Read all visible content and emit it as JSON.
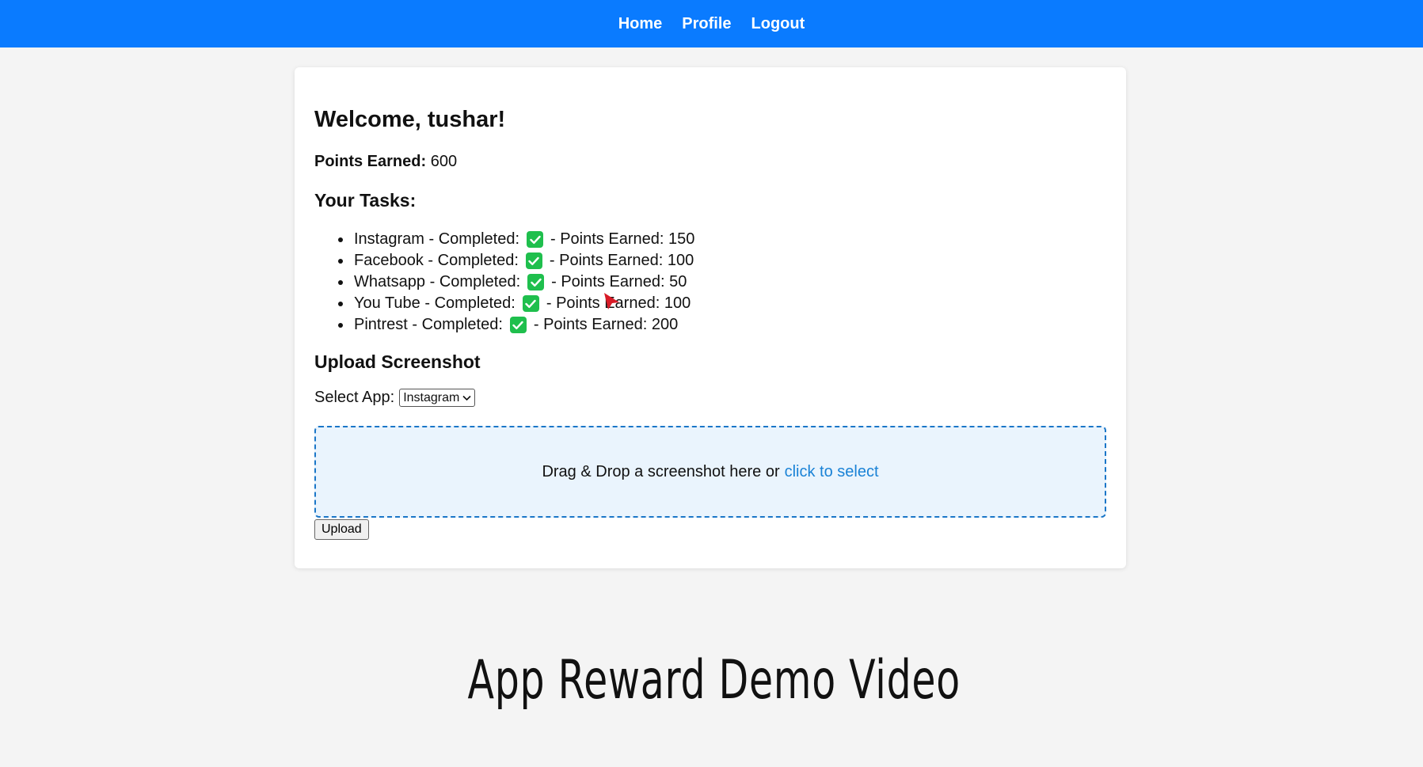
{
  "nav": {
    "links": [
      "Home",
      "Profile",
      "Logout"
    ]
  },
  "dashboard": {
    "welcome": "Welcome, tushar!",
    "points_label": "Points Earned:",
    "points_value": "600",
    "tasks_title": "Your Tasks:",
    "tasks": [
      {
        "app": "Instagram",
        "completed_label": "Completed:",
        "points_label": "Points Earned:",
        "points": "150",
        "completed": true
      },
      {
        "app": "Facebook",
        "completed_label": "Completed:",
        "points_label": "Points Earned:",
        "points": "100",
        "completed": true
      },
      {
        "app": "Whatsapp",
        "completed_label": "Completed:",
        "points_label": "Points Earned:",
        "points": "50",
        "completed": true
      },
      {
        "app": "You Tube",
        "completed_label": "Completed:",
        "points_label": "Points Earned:",
        "points": "100",
        "completed": true
      },
      {
        "app": "Pintrest",
        "completed_label": "Completed:",
        "points_label": "Points Earned:",
        "points": "200",
        "completed": true
      }
    ],
    "check_icon": "check-box-icon",
    "check_color": "#1fbf4d"
  },
  "upload": {
    "title": "Upload Screenshot",
    "select_label": "Select App:",
    "select_value": "Instagram",
    "dropzone_text": "Drag & Drop a screenshot here or",
    "dropzone_link": "click to select",
    "button_label": "Upload"
  },
  "caption": "App Reward Demo Video",
  "colors": {
    "navbar": "#0a7bff",
    "dropzone_border": "#1a76c8",
    "dropzone_bg": "#eaf4fd",
    "link": "#1a82d6"
  }
}
